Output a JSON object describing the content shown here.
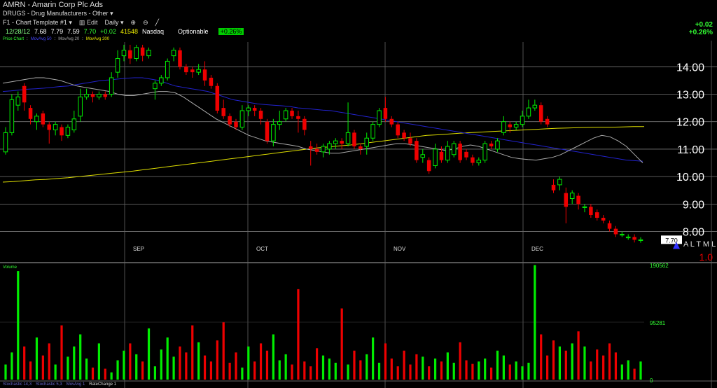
{
  "header": {
    "symbol": "AMRN",
    "company": "Amarin Corp Plc Ads",
    "industry": "DRUGS - Drug Manufacturers - Other",
    "template": "F1 - Chart Template #1",
    "edit_label": "Edit",
    "period": "Daily",
    "date": "12/28/12",
    "open": "7.68",
    "high": "7.79",
    "low": "7.59",
    "close": "7.70",
    "change": "+0.02",
    "volume": "41548",
    "exchange": "Nasdaq",
    "optionable": "Optionable",
    "pct_badge": "+0.26%",
    "right_change": "+0.02",
    "right_pct": "+0.26%"
  },
  "legend": {
    "price_chart": "Price Chart",
    "ma50": "MovAvg 50",
    "ma20": "MovAvg 20",
    "ma200": "MovAvg 200"
  },
  "volume_label": "Volume",
  "footer": {
    "item1": "Stochastic 14,3",
    "item2": "Stochastic 5,3",
    "item3": "MovAvg 1",
    "item4": "RateChange 1"
  },
  "side_labels": {
    "last_price": "7.70",
    "altml": "A L T M L",
    "ratio": "1.0"
  },
  "colors": {
    "up": "#00ee00",
    "down": "#ee0000",
    "ma50": "#2222cc",
    "ma20": "#aaaaaa",
    "ma200": "#dddd00"
  },
  "chart_data": {
    "type": "candlestick",
    "price_axis": {
      "ylim": [
        7.3,
        14.9
      ],
      "ticks": [
        "14.00",
        "13.00",
        "12.00",
        "11.00",
        "10.00",
        "9.00",
        "8.00"
      ]
    },
    "months": [
      "SEP",
      "OCT",
      "NOV",
      "DEC"
    ],
    "volume_axis": {
      "ylim": [
        0,
        190562
      ],
      "ticks": [
        "190562",
        "95281",
        "0"
      ]
    },
    "candles": [
      {
        "o": 10.9,
        "c": 11.6,
        "h": 11.8,
        "l": 10.8
      },
      {
        "o": 11.6,
        "c": 12.8,
        "h": 13.0,
        "l": 11.5
      },
      {
        "o": 12.6,
        "c": 12.9,
        "h": 13.1,
        "l": 12.4
      },
      {
        "o": 13.3,
        "c": 12.7,
        "h": 13.4,
        "l": 12.4
      },
      {
        "o": 12.5,
        "c": 12.1,
        "h": 12.6,
        "l": 11.9
      },
      {
        "o": 12.0,
        "c": 12.2,
        "h": 12.3,
        "l": 11.7
      },
      {
        "o": 12.3,
        "c": 11.9,
        "h": 12.4,
        "l": 11.8
      },
      {
        "o": 11.9,
        "c": 11.7,
        "h": 12.0,
        "l": 11.2
      },
      {
        "o": 11.7,
        "c": 11.9,
        "h": 12.0,
        "l": 11.5
      },
      {
        "o": 11.8,
        "c": 11.5,
        "h": 11.9,
        "l": 11.3
      },
      {
        "o": 11.5,
        "c": 11.8,
        "h": 11.9,
        "l": 11.4
      },
      {
        "o": 11.7,
        "c": 12.1,
        "h": 12.4,
        "l": 11.6
      },
      {
        "o": 12.2,
        "c": 12.9,
        "h": 13.2,
        "l": 12.0
      },
      {
        "o": 12.9,
        "c": 13.0,
        "h": 13.2,
        "l": 12.8
      },
      {
        "o": 13.0,
        "c": 12.9,
        "h": 13.1,
        "l": 12.7
      },
      {
        "o": 12.9,
        "c": 13.0,
        "h": 13.1,
        "l": 12.8
      },
      {
        "o": 13.0,
        "c": 12.9,
        "h": 13.1,
        "l": 12.8
      },
      {
        "o": 13.0,
        "c": 13.6,
        "h": 13.8,
        "l": 12.9
      },
      {
        "o": 13.8,
        "c": 14.3,
        "h": 14.6,
        "l": 13.6
      },
      {
        "o": 14.4,
        "c": 14.6,
        "h": 14.8,
        "l": 14.2
      },
      {
        "o": 14.6,
        "c": 14.3,
        "h": 14.8,
        "l": 14.1
      },
      {
        "o": 14.3,
        "c": 14.7,
        "h": 14.8,
        "l": 14.2
      },
      {
        "o": 14.7,
        "c": 14.4,
        "h": 14.8,
        "l": 14.2
      },
      {
        "o": 14.4,
        "c": 14.6,
        "h": 14.7,
        "l": 14.3
      },
      {
        "o": 13.2,
        "c": 13.4,
        "h": 13.5,
        "l": 12.8
      },
      {
        "o": 13.4,
        "c": 13.6,
        "h": 13.7,
        "l": 13.3
      },
      {
        "o": 13.6,
        "c": 14.2,
        "h": 14.3,
        "l": 13.5
      },
      {
        "o": 14.4,
        "c": 14.6,
        "h": 14.7,
        "l": 14.2
      },
      {
        "o": 14.6,
        "c": 14.0,
        "h": 14.7,
        "l": 13.9
      },
      {
        "o": 14.0,
        "c": 13.8,
        "h": 14.1,
        "l": 13.7
      },
      {
        "o": 13.9,
        "c": 13.8,
        "h": 14.0,
        "l": 13.6
      },
      {
        "o": 13.8,
        "c": 13.9,
        "h": 14.1,
        "l": 13.7
      },
      {
        "o": 13.9,
        "c": 13.5,
        "h": 14.2,
        "l": 13.3
      },
      {
        "o": 13.6,
        "c": 13.3,
        "h": 13.7,
        "l": 13.2
      },
      {
        "o": 13.3,
        "c": 12.4,
        "h": 13.4,
        "l": 12.3
      },
      {
        "o": 12.5,
        "c": 12.2,
        "h": 12.8,
        "l": 12.1
      },
      {
        "o": 12.2,
        "c": 11.9,
        "h": 12.3,
        "l": 11.8
      },
      {
        "o": 12.0,
        "c": 11.8,
        "h": 12.1,
        "l": 11.7
      },
      {
        "o": 11.8,
        "c": 12.4,
        "h": 12.6,
        "l": 11.7
      },
      {
        "o": 12.4,
        "c": 12.5,
        "h": 12.6,
        "l": 12.2
      },
      {
        "o": 12.5,
        "c": 12.4,
        "h": 12.6,
        "l": 12.2
      },
      {
        "o": 12.4,
        "c": 12.1,
        "h": 12.5,
        "l": 11.9
      },
      {
        "o": 12.0,
        "c": 11.3,
        "h": 12.1,
        "l": 11.2
      },
      {
        "o": 11.3,
        "c": 11.9,
        "h": 12.1,
        "l": 11.1
      },
      {
        "o": 11.9,
        "c": 12.0,
        "h": 12.4,
        "l": 11.7
      },
      {
        "o": 12.1,
        "c": 12.4,
        "h": 12.5,
        "l": 12.0
      },
      {
        "o": 12.4,
        "c": 12.2,
        "h": 12.5,
        "l": 12.1
      },
      {
        "o": 12.2,
        "c": 12.1,
        "h": 12.4,
        "l": 11.6
      },
      {
        "o": 12.1,
        "c": 11.7,
        "h": 12.2,
        "l": 11.5
      },
      {
        "o": 11.1,
        "c": 11.0,
        "h": 11.3,
        "l": 10.4
      },
      {
        "o": 11.0,
        "c": 10.9,
        "h": 11.2,
        "l": 10.8
      },
      {
        "o": 10.9,
        "c": 11.1,
        "h": 11.2,
        "l": 10.7
      },
      {
        "o": 11.0,
        "c": 11.2,
        "h": 11.3,
        "l": 10.8
      },
      {
        "o": 11.2,
        "c": 11.3,
        "h": 11.4,
        "l": 11.0
      },
      {
        "o": 11.3,
        "c": 11.2,
        "h": 11.4,
        "l": 11.0
      },
      {
        "o": 11.2,
        "c": 11.6,
        "h": 12.7,
        "l": 11.1
      },
      {
        "o": 11.6,
        "c": 11.1,
        "h": 11.7,
        "l": 11.0
      },
      {
        "o": 11.1,
        "c": 11.0,
        "h": 11.2,
        "l": 10.8
      },
      {
        "o": 11.1,
        "c": 11.4,
        "h": 11.6,
        "l": 10.8
      },
      {
        "o": 11.4,
        "c": 11.9,
        "h": 12.0,
        "l": 11.3
      },
      {
        "o": 11.9,
        "c": 12.4,
        "h": 12.5,
        "l": 11.8
      },
      {
        "o": 12.5,
        "c": 12.1,
        "h": 12.9,
        "l": 12.0
      },
      {
        "o": 12.1,
        "c": 11.9,
        "h": 12.2,
        "l": 11.8
      },
      {
        "o": 11.9,
        "c": 11.5,
        "h": 12.0,
        "l": 11.4
      },
      {
        "o": 11.6,
        "c": 11.4,
        "h": 11.7,
        "l": 11.3
      },
      {
        "o": 11.4,
        "c": 11.2,
        "h": 11.6,
        "l": 11.1
      },
      {
        "o": 11.3,
        "c": 10.6,
        "h": 11.4,
        "l": 10.5
      },
      {
        "o": 10.7,
        "c": 10.8,
        "h": 11.0,
        "l": 10.5
      },
      {
        "o": 10.6,
        "c": 10.2,
        "h": 10.7,
        "l": 10.1
      },
      {
        "o": 10.4,
        "c": 11.0,
        "h": 11.2,
        "l": 10.3
      },
      {
        "o": 10.9,
        "c": 10.6,
        "h": 11.1,
        "l": 10.5
      },
      {
        "o": 10.6,
        "c": 11.1,
        "h": 11.3,
        "l": 10.5
      },
      {
        "o": 10.8,
        "c": 11.2,
        "h": 11.3,
        "l": 10.7
      },
      {
        "o": 11.2,
        "c": 10.6,
        "h": 11.3,
        "l": 10.5
      },
      {
        "o": 10.9,
        "c": 10.7,
        "h": 11.0,
        "l": 10.6
      },
      {
        "o": 10.7,
        "c": 10.5,
        "h": 10.8,
        "l": 10.4
      },
      {
        "o": 10.5,
        "c": 10.6,
        "h": 10.7,
        "l": 10.4
      },
      {
        "o": 10.6,
        "c": 11.2,
        "h": 11.3,
        "l": 10.5
      },
      {
        "o": 11.2,
        "c": 11.1,
        "h": 11.3,
        "l": 11.0
      },
      {
        "o": 11.0,
        "c": 11.3,
        "h": 11.4,
        "l": 10.9
      },
      {
        "o": 11.6,
        "c": 12.0,
        "h": 12.2,
        "l": 11.5
      },
      {
        "o": 11.9,
        "c": 11.8,
        "h": 12.0,
        "l": 11.6
      },
      {
        "o": 11.8,
        "c": 11.9,
        "h": 12.0,
        "l": 11.7
      },
      {
        "o": 11.9,
        "c": 12.2,
        "h": 12.4,
        "l": 11.8
      },
      {
        "o": 12.2,
        "c": 12.5,
        "h": 12.8,
        "l": 12.1
      },
      {
        "o": 12.5,
        "c": 12.6,
        "h": 12.8,
        "l": 12.4
      },
      {
        "o": 12.6,
        "c": 12.0,
        "h": 12.7,
        "l": 11.9
      },
      {
        "o": 12.1,
        "c": 11.9,
        "h": 12.2,
        "l": 11.8
      },
      {
        "o": 9.7,
        "c": 9.5,
        "h": 9.9,
        "l": 9.4
      },
      {
        "o": 9.7,
        "c": 9.9,
        "h": 10.0,
        "l": 9.5
      },
      {
        "o": 9.4,
        "c": 8.9,
        "h": 9.6,
        "l": 8.3
      },
      {
        "o": 9.2,
        "c": 9.4,
        "h": 9.5,
        "l": 9.0
      },
      {
        "o": 9.3,
        "c": 9.0,
        "h": 9.4,
        "l": 8.8
      },
      {
        "o": 8.9,
        "c": 8.9,
        "h": 9.0,
        "l": 8.7
      },
      {
        "o": 8.9,
        "c": 8.6,
        "h": 9.0,
        "l": 8.5
      },
      {
        "o": 8.7,
        "c": 8.5,
        "h": 8.8,
        "l": 8.4
      },
      {
        "o": 8.5,
        "c": 8.4,
        "h": 8.6,
        "l": 8.3
      },
      {
        "o": 8.3,
        "c": 8.1,
        "h": 8.4,
        "l": 8.0
      },
      {
        "o": 8.1,
        "c": 7.9,
        "h": 8.2,
        "l": 7.8
      },
      {
        "o": 7.9,
        "c": 7.9,
        "h": 8.0,
        "l": 7.8
      },
      {
        "o": 7.8,
        "c": 7.8,
        "h": 7.9,
        "l": 7.7
      },
      {
        "o": 7.8,
        "c": 7.7,
        "h": 7.9,
        "l": 7.6
      },
      {
        "o": 7.68,
        "c": 7.7,
        "h": 7.79,
        "l": 7.59
      }
    ],
    "volume_values": [
      25000,
      45000,
      180000,
      55000,
      30000,
      70000,
      40000,
      60000,
      25000,
      90000,
      38000,
      55000,
      75000,
      35000,
      20000,
      60000,
      18000,
      12000,
      32000,
      48000,
      60000,
      42000,
      30000,
      85000,
      22000,
      50000,
      70000,
      38000,
      55000,
      45000,
      90000,
      62000,
      40000,
      30000,
      65000,
      95000,
      28000,
      45000,
      20000,
      55000,
      30000,
      60000,
      48000,
      75000,
      32000,
      42000,
      25000,
      150000,
      30000,
      22000,
      52000,
      40000,
      35000,
      28000,
      118000,
      25000,
      48000,
      32000,
      42000,
      70000,
      28000,
      60000,
      35000,
      22000,
      48000,
      25000,
      42000,
      38000,
      22000,
      35000,
      30000,
      45000,
      28000,
      62000,
      32000,
      26000,
      30000,
      35000,
      20000,
      48000,
      40000,
      25000,
      30000,
      22000,
      28000,
      190000,
      75000,
      40000,
      65000,
      55000,
      48000,
      60000,
      80000,
      55000,
      30000,
      50000,
      40000,
      60000,
      45000,
      25000,
      32000,
      18000,
      30000
    ],
    "ma50": [
      13.1,
      13.12,
      13.15,
      13.18,
      13.2,
      13.22,
      13.25,
      13.28,
      13.3,
      13.35,
      13.4,
      13.45,
      13.5,
      13.52,
      13.55,
      13.58,
      13.6,
      13.6,
      13.55,
      13.5,
      13.4,
      13.3,
      13.25,
      13.2,
      13.15,
      13.1,
      13.0,
      12.9,
      12.8,
      12.75,
      12.7,
      12.65,
      12.62,
      12.6,
      12.58,
      12.55,
      12.5,
      12.48,
      12.45,
      12.42,
      12.4,
      12.35,
      12.3,
      12.25,
      12.2,
      12.15,
      12.1,
      12.05,
      12.0,
      11.95,
      11.9,
      11.85,
      11.8,
      11.75,
      11.7,
      11.65,
      11.6,
      11.55,
      11.5,
      11.45,
      11.4,
      11.35,
      11.3,
      11.25,
      11.2,
      11.15,
      11.1,
      11.05,
      11.0,
      10.95,
      10.9,
      10.85,
      10.8,
      10.75,
      10.7,
      10.65,
      10.6,
      10.58,
      10.56
    ],
    "ma20": [
      13.4,
      13.45,
      13.5,
      13.55,
      13.6,
      13.6,
      13.55,
      13.5,
      13.4,
      13.3,
      13.25,
      13.2,
      13.15,
      13.1,
      13.0,
      12.95,
      12.95,
      13.0,
      13.05,
      13.1,
      13.1,
      13.05,
      12.9,
      12.7,
      12.5,
      12.3,
      12.1,
      11.95,
      11.8,
      11.65,
      11.5,
      11.4,
      11.3,
      11.25,
      11.2,
      11.15,
      11.1,
      11.0,
      10.95,
      10.9,
      10.85,
      10.85,
      10.9,
      10.95,
      11.0,
      11.05,
      11.1,
      11.15,
      11.2,
      11.2,
      11.15,
      11.1,
      11.05,
      11.0,
      10.95,
      11.0,
      11.1,
      11.15,
      11.1,
      11.0,
      10.9,
      10.8,
      10.7,
      10.65,
      10.62,
      10.6,
      10.65,
      10.7,
      10.8,
      10.95,
      11.1,
      11.25,
      11.4,
      11.5,
      11.45,
      11.3,
      11.1,
      10.8,
      10.5
    ],
    "ma200": [
      9.8,
      9.82,
      9.85,
      9.88,
      9.9,
      9.93,
      9.96,
      10.0,
      10.04,
      10.08,
      10.12,
      10.16,
      10.2,
      10.25,
      10.3,
      10.35,
      10.4,
      10.45,
      10.5,
      10.55,
      10.6,
      10.65,
      10.7,
      10.75,
      10.8,
      10.85,
      10.9,
      10.95,
      11.0,
      11.05,
      11.08,
      11.12,
      11.15,
      11.2,
      11.25,
      11.3,
      11.35,
      11.4,
      11.45,
      11.5,
      11.52,
      11.55,
      11.58,
      11.6,
      11.62,
      11.64,
      11.66,
      11.68,
      11.7,
      11.72,
      11.74,
      11.76,
      11.77,
      11.78,
      11.79,
      11.8,
      11.8,
      11.81,
      11.82,
      11.82
    ]
  }
}
